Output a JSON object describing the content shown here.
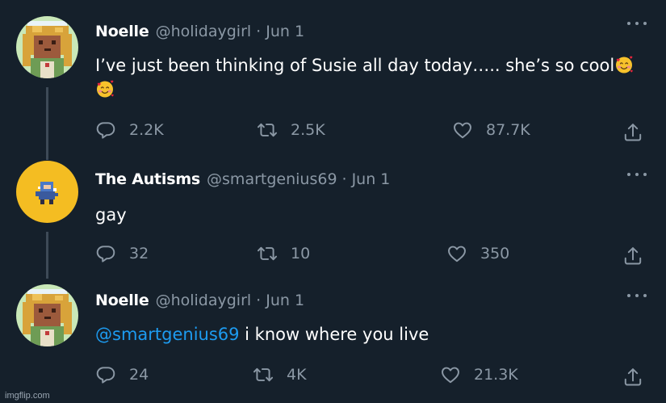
{
  "colors": {
    "background": "#15202b",
    "muted": "#8b98a5",
    "accent": "#1d9bf0",
    "thread_line": "#3d4a57"
  },
  "tweets": [
    {
      "name": "Noelle",
      "handle": "@holidaygirl",
      "separator": "·",
      "date": "Jun 1",
      "mention": "",
      "text": "I’ve just been thinking of Susie all day today….. she’s so cool",
      "emojis": [
        "smiling-face-with-hearts",
        "smiling-face-with-hearts"
      ],
      "replies": "2.2K",
      "retweets": "2.5K",
      "likes": "87.7K"
    },
    {
      "name": "The Autisms",
      "handle": "@smartgenius69",
      "separator": "·",
      "date": "Jun 1",
      "mention": "",
      "text": "gay",
      "replies": "32",
      "retweets": "10",
      "likes": "350"
    },
    {
      "name": "Noelle",
      "handle": "@holidaygirl",
      "separator": "·",
      "date": "Jun 1",
      "mention": "@smartgenius69",
      "text": " i know where you live",
      "replies": "24",
      "retweets": "4K",
      "likes": "21.3K"
    }
  ],
  "icons": [
    "reply-icon",
    "retweet-icon",
    "like-icon",
    "share-icon",
    "more-icon"
  ],
  "watermark": "imgflip.com"
}
